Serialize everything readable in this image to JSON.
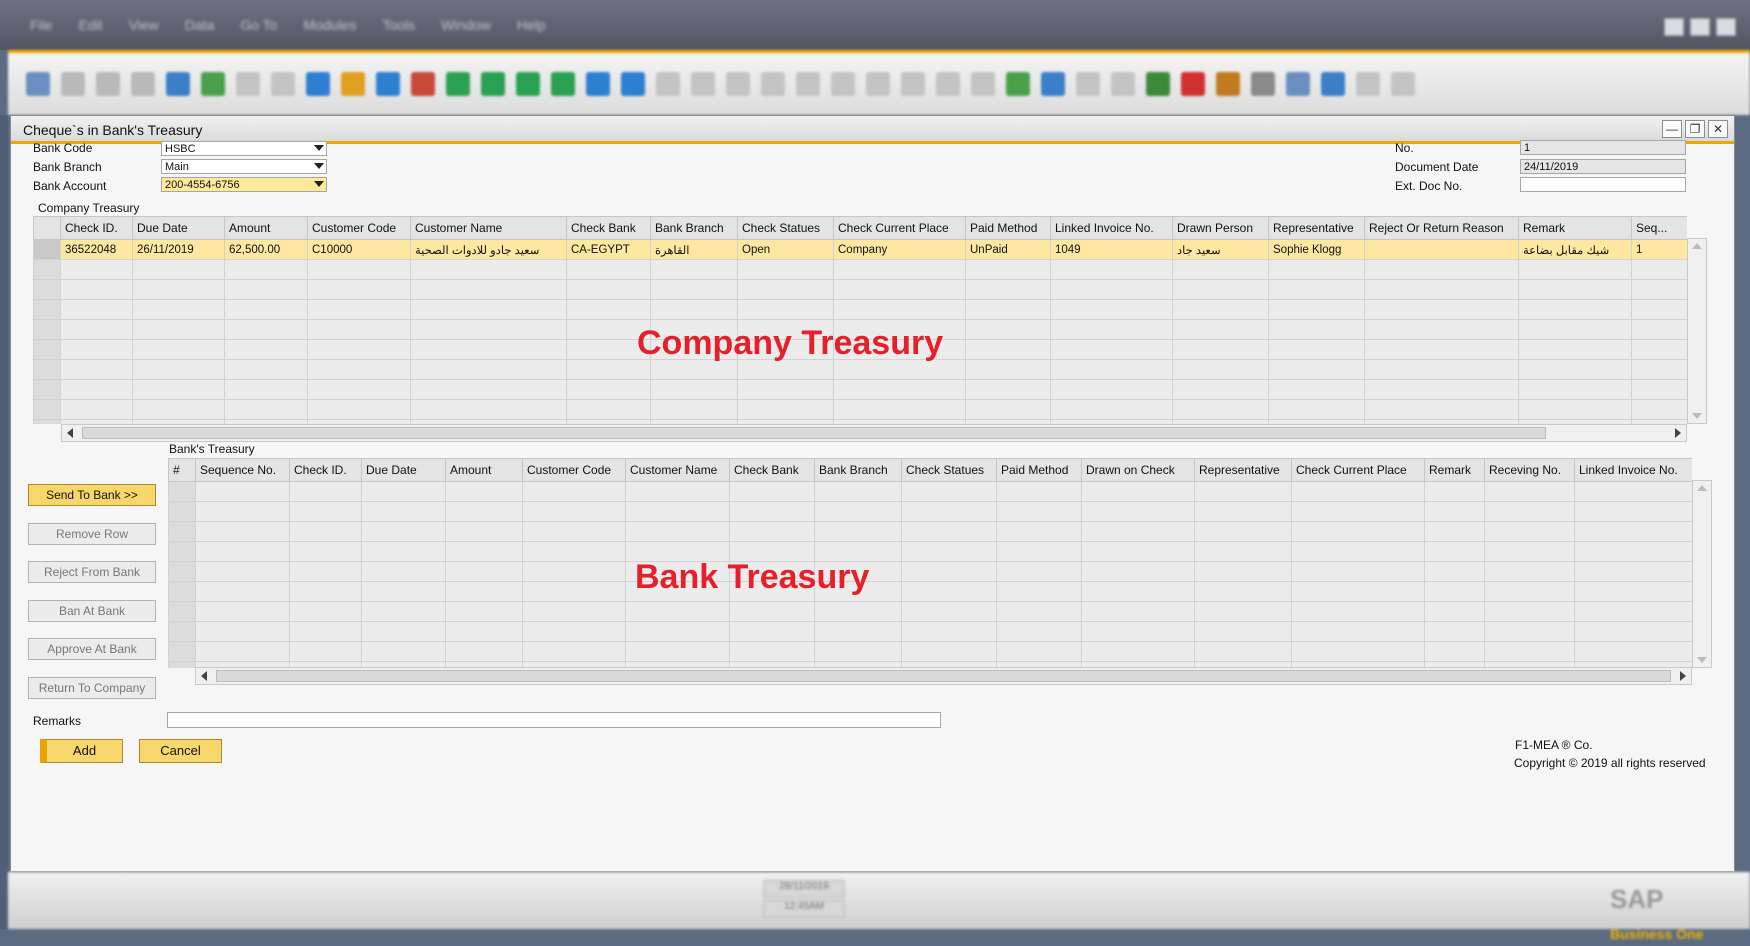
{
  "menu": [
    "File",
    "Edit",
    "View",
    "Data",
    "Go To",
    "Modules",
    "Tools",
    "Window",
    "Help"
  ],
  "window": {
    "title": "Cheque`s in Bank's Treasury"
  },
  "header": {
    "bank_code_label": "Bank Code",
    "bank_code_value": "HSBC",
    "bank_branch_label": "Bank Branch",
    "bank_branch_value": "Main",
    "bank_account_label": "Bank Account",
    "bank_account_value": "200-4554-6756",
    "no_label": "No.",
    "no_value": "1",
    "doc_date_label": "Document Date",
    "doc_date_value": "24/11/2019",
    "ext_doc_label": "Ext. Doc No.",
    "ext_doc_value": ""
  },
  "company_treasury": {
    "section_label": "Company Treasury",
    "overlay": "Company Treasury",
    "columns": [
      "Check ID.",
      "Due Date",
      "Amount",
      "Customer Code",
      "Customer Name",
      "Check Bank",
      "Bank Branch",
      "Check Statues",
      "Check Current Place",
      "Paid Method",
      "Linked Invoice No.",
      "Drawn Person",
      "Representative",
      "Reject Or Return Reason",
      "Remark",
      "Seq..."
    ],
    "rows": [
      [
        "36522048",
        "26/11/2019",
        "62,500.00",
        "C10000",
        "سعيد جادو للادوات الصحية",
        "CA-EGYPT",
        "القاهرة",
        "Open",
        "Company",
        "UnPaid",
        "1049",
        "سعيد جاد",
        "Sophie Klogg",
        "",
        "شيك مقابل بضاعة",
        "1"
      ]
    ]
  },
  "bank_treasury": {
    "section_label": "Bank's Treasury",
    "overlay": "Bank Treasury",
    "columns": [
      "#",
      "Sequence No.",
      "Check ID.",
      "Due Date",
      "Amount",
      "Customer Code",
      "Customer Name",
      "Check Bank",
      "Bank Branch",
      "Check Statues",
      "Paid Method",
      "Drawn on Check",
      "Representative",
      "Check Current Place",
      "Remark",
      "Receving No.",
      "Linked Invoice No."
    ]
  },
  "side_buttons": {
    "send": "Send To Bank >>",
    "remove": "Remove Row",
    "reject": "Reject From Bank",
    "ban": "Ban At Bank",
    "approve": "Approve At Bank",
    "return": "Return To Company"
  },
  "footer": {
    "remarks_label": "Remarks",
    "remarks_value": "",
    "add_label": "Add",
    "cancel_label": "Cancel",
    "company": "F1-MEA ® Co.",
    "copyright": "Copyright © 2019 all rights reserved"
  },
  "statusbar": {
    "date": "28/11/2019",
    "time": "12:45AM",
    "logo_main": "SAP",
    "logo_sub": "Business One"
  },
  "colors": {
    "accent": "#f0a800",
    "selected_row": "#fde7a1",
    "overlay_text": "#e5202a"
  }
}
